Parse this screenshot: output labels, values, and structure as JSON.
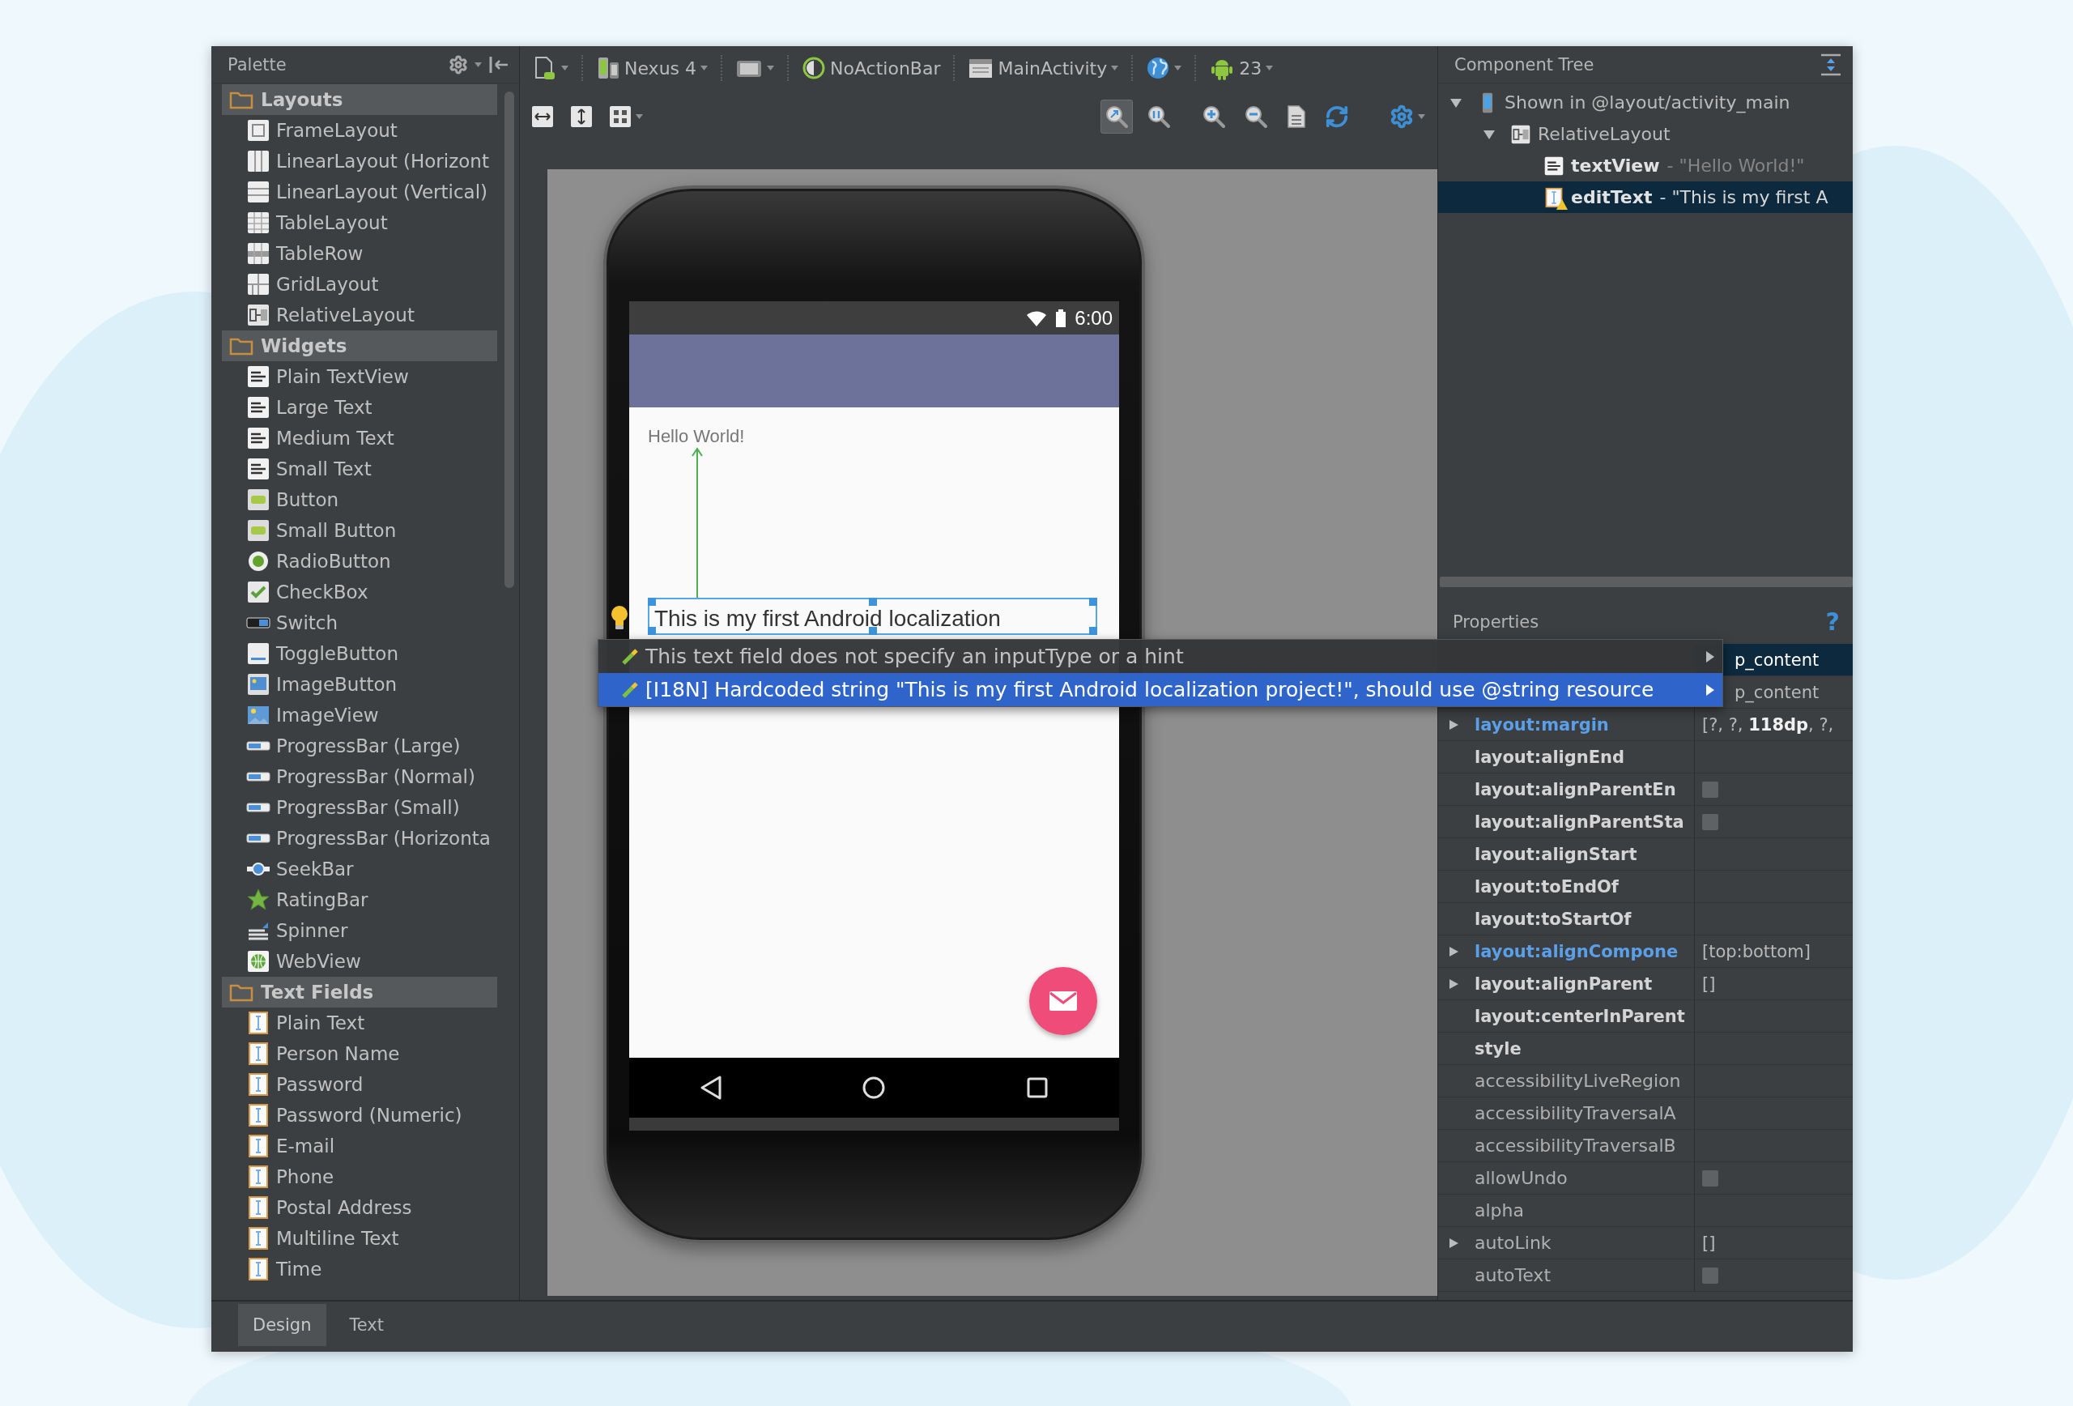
{
  "palette": {
    "title": "Palette",
    "groups": [
      {
        "label": "Layouts",
        "expanded": true,
        "items": [
          {
            "label": "FrameLayout",
            "kind": "frame"
          },
          {
            "label": "LinearLayout (Horizont",
            "kind": "hlinear"
          },
          {
            "label": "LinearLayout (Vertical)",
            "kind": "vlinear"
          },
          {
            "label": "TableLayout",
            "kind": "table"
          },
          {
            "label": "TableRow",
            "kind": "tablerow"
          },
          {
            "label": "GridLayout",
            "kind": "grid"
          },
          {
            "label": "RelativeLayout",
            "kind": "relative"
          }
        ]
      },
      {
        "label": "Widgets",
        "expanded": true,
        "items": [
          {
            "label": "Plain TextView",
            "kind": "text"
          },
          {
            "label": "Large Text",
            "kind": "text"
          },
          {
            "label": "Medium Text",
            "kind": "text"
          },
          {
            "label": "Small Text",
            "kind": "text"
          },
          {
            "label": "Button",
            "kind": "button"
          },
          {
            "label": "Small Button",
            "kind": "button"
          },
          {
            "label": "RadioButton",
            "kind": "radio"
          },
          {
            "label": "CheckBox",
            "kind": "checkbox"
          },
          {
            "label": "Switch",
            "kind": "switch"
          },
          {
            "label": "ToggleButton",
            "kind": "toggle"
          },
          {
            "label": "ImageButton",
            "kind": "imagebutton"
          },
          {
            "label": "ImageView",
            "kind": "image"
          },
          {
            "label": "ProgressBar (Large)",
            "kind": "progress"
          },
          {
            "label": "ProgressBar (Normal)",
            "kind": "progress"
          },
          {
            "label": "ProgressBar (Small)",
            "kind": "progress"
          },
          {
            "label": "ProgressBar (Horizonta",
            "kind": "progress"
          },
          {
            "label": "SeekBar",
            "kind": "seekbar"
          },
          {
            "label": "RatingBar",
            "kind": "rating"
          },
          {
            "label": "Spinner",
            "kind": "spinner"
          },
          {
            "label": "WebView",
            "kind": "web"
          }
        ]
      },
      {
        "label": "Text Fields",
        "expanded": true,
        "items": [
          {
            "label": "Plain Text",
            "kind": "field"
          },
          {
            "label": "Person Name",
            "kind": "field"
          },
          {
            "label": "Password",
            "kind": "field"
          },
          {
            "label": "Password (Numeric)",
            "kind": "field"
          },
          {
            "label": "E-mail",
            "kind": "field"
          },
          {
            "label": "Phone",
            "kind": "field"
          },
          {
            "label": "Postal Address",
            "kind": "field"
          },
          {
            "label": "Multiline Text",
            "kind": "field"
          },
          {
            "label": "Time",
            "kind": "field"
          }
        ]
      }
    ]
  },
  "toolbar": {
    "config": [
      {
        "kind": "device",
        "dropdown": true
      },
      {
        "kind": "nexus",
        "label": "Nexus 4",
        "dropdown": true
      },
      {
        "kind": "orientation",
        "dropdown": true
      },
      {
        "kind": "theme",
        "label": "NoActionBar",
        "dropdown": false
      },
      {
        "kind": "activity",
        "label": "MainActivity",
        "dropdown": true
      },
      {
        "kind": "locale",
        "dropdown": true
      },
      {
        "kind": "api",
        "label": "23",
        "dropdown": true
      }
    ],
    "layout_tools": [
      {
        "kind": "hfill",
        "dropdown": false
      },
      {
        "kind": "vfill",
        "dropdown": false
      },
      {
        "kind": "grid",
        "dropdown": true
      }
    ],
    "zoom_tools": [
      {
        "kind": "fit",
        "selected": true,
        "dropdown": false
      },
      {
        "kind": "actual",
        "selected": false,
        "dropdown": false
      },
      {
        "kind": "zoomin",
        "selected": false,
        "dropdown": false
      },
      {
        "kind": "zoomout",
        "selected": false,
        "dropdown": false
      },
      {
        "kind": "page",
        "selected": false,
        "dropdown": false
      },
      {
        "kind": "refresh",
        "selected": false,
        "dropdown": false
      },
      {
        "kind": "settings",
        "selected": false,
        "dropdown": true
      }
    ]
  },
  "preview": {
    "status_time": "6:00",
    "text_view": "Hello World!",
    "edit_text": {
      "value": "This is my first Android localization",
      "selected": true,
      "warning": true
    }
  },
  "lint_menu": {
    "items": [
      {
        "label": "This text field does not specify an inputType or a hint",
        "selected": false
      },
      {
        "label": "[I18N] Hardcoded string \"This is my first Android localization project!\", should use @string resource",
        "selected": true
      }
    ]
  },
  "component_tree": {
    "title": "Component Tree",
    "nodes": [
      {
        "label": "Shown in @layout/activity_main",
        "kind": "device",
        "expanded": true,
        "selected": false,
        "children": [
          {
            "label": "RelativeLayout",
            "kind": "relative",
            "expanded": true,
            "selected": false,
            "children": [
              {
                "label": "textView",
                "detail": "- \"Hello World!\"",
                "kind": "text",
                "warning": false,
                "selected": false
              },
              {
                "label": "editText",
                "detail": "- \"This is my first A",
                "kind": "field",
                "warning": true,
                "selected": true
              }
            ]
          }
        ]
      }
    ]
  },
  "properties": {
    "title": "Properties",
    "help": "?",
    "rows": [
      {
        "value": "p_content",
        "kind": "text",
        "selected": true
      },
      {
        "value": "p_content",
        "kind": "text",
        "selected": false
      },
      {
        "name": "layout:margin",
        "value": "[?, ?, **118dp**, ?,",
        "kind": "text",
        "expanded": false,
        "modified": true,
        "emphasized": true,
        "selected": false
      },
      {
        "name": "layout:alignEnd",
        "kind": "text",
        "modified": false,
        "emphasized": true,
        "selected": false
      },
      {
        "name": "layout:alignParentEn",
        "kind": "checkbox",
        "checked": false,
        "modified": false,
        "emphasized": true,
        "selected": false
      },
      {
        "name": "layout:alignParentSta",
        "kind": "checkbox",
        "checked": false,
        "modified": false,
        "emphasized": true,
        "selected": false
      },
      {
        "name": "layout:alignStart",
        "kind": "text",
        "modified": false,
        "emphasized": true,
        "selected": false
      },
      {
        "name": "layout:toEndOf",
        "kind": "text",
        "modified": false,
        "emphasized": true,
        "selected": false
      },
      {
        "name": "layout:toStartOf",
        "kind": "text",
        "modified": false,
        "emphasized": true,
        "selected": false
      },
      {
        "name": "layout:alignCompone",
        "value": "[top:bottom]",
        "kind": "text",
        "expanded": false,
        "modified": true,
        "emphasized": true,
        "selected": false
      },
      {
        "name": "layout:alignParent",
        "value": "[]",
        "kind": "text",
        "expanded": false,
        "modified": false,
        "emphasized": true,
        "selected": false
      },
      {
        "name": "layout:centerInParent",
        "kind": "text",
        "modified": false,
        "emphasized": true,
        "selected": false
      },
      {
        "name": "style",
        "kind": "text",
        "modified": false,
        "emphasized": true,
        "selected": false
      },
      {
        "name": "accessibilityLiveRegion",
        "kind": "text",
        "modified": false,
        "emphasized": false,
        "selected": false
      },
      {
        "name": "accessibilityTraversalA",
        "kind": "text",
        "modified": false,
        "emphasized": false,
        "selected": false
      },
      {
        "name": "accessibilityTraversalB",
        "kind": "text",
        "modified": false,
        "emphasized": false,
        "selected": false
      },
      {
        "name": "allowUndo",
        "kind": "checkbox",
        "checked": false,
        "modified": false,
        "emphasized": false,
        "selected": false
      },
      {
        "name": "alpha",
        "kind": "text",
        "modified": false,
        "emphasized": false,
        "selected": false
      },
      {
        "name": "autoLink",
        "value": "[]",
        "kind": "text",
        "expanded": false,
        "modified": false,
        "emphasized": false,
        "selected": false
      },
      {
        "name": "autoText",
        "kind": "checkbox",
        "checked": false,
        "modified": false,
        "emphasized": false,
        "selected": false
      }
    ]
  },
  "editor_tabs": [
    {
      "label": "Design",
      "selected": true
    },
    {
      "label": "Text",
      "selected": false
    }
  ]
}
